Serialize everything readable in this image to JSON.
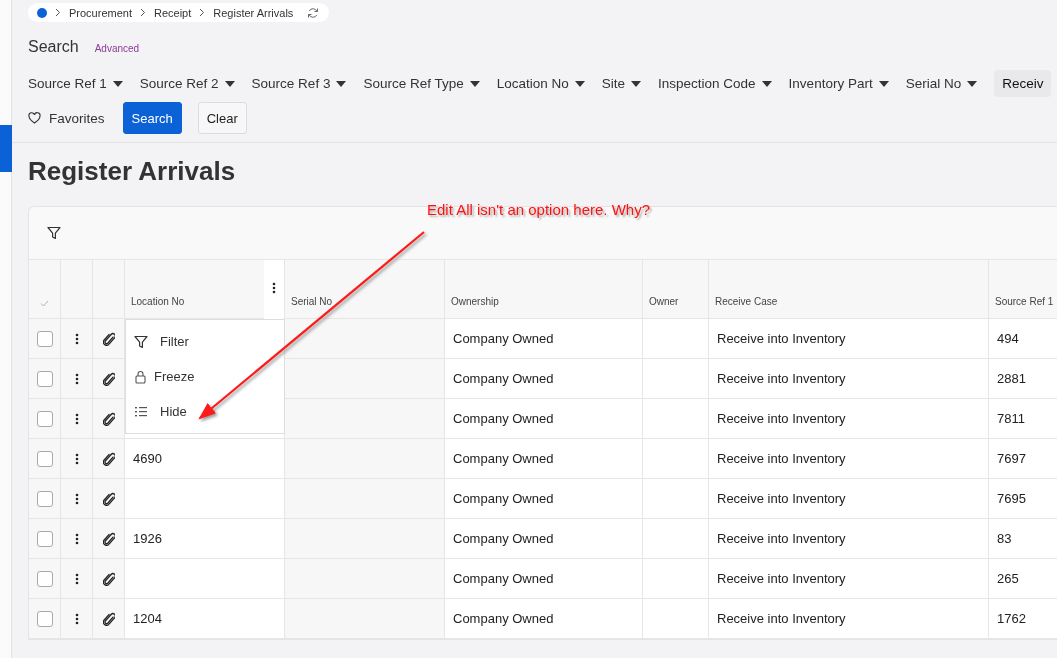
{
  "breadcrumb": [
    "Procurement",
    "Receipt",
    "Register Arrivals"
  ],
  "search": {
    "title": "Search",
    "advanced_link": "Advanced"
  },
  "filters": [
    {
      "label": "Source Ref 1",
      "active": false
    },
    {
      "label": "Source Ref 2",
      "active": false
    },
    {
      "label": "Source Ref 3",
      "active": false
    },
    {
      "label": "Source Ref Type",
      "active": false
    },
    {
      "label": "Location No",
      "active": false
    },
    {
      "label": "Site",
      "active": false
    },
    {
      "label": "Inspection Code",
      "active": false
    },
    {
      "label": "Inventory Part",
      "active": false
    },
    {
      "label": "Serial No",
      "active": false
    },
    {
      "label": "Receiv",
      "active": true
    }
  ],
  "favorites": "Favorites",
  "buttons": [
    {
      "label": "Search",
      "kind": "primary"
    },
    {
      "label": "Clear",
      "kind": "secondary"
    }
  ],
  "page_title": "Register Arrivals",
  "table": {
    "columns": [
      "Location No",
      "Serial No",
      "Ownership",
      "Owner",
      "Receive Case",
      "Source Ref 1"
    ],
    "rows": [
      {
        "checked": false,
        "location_no": null,
        "ownership": "Company Owned",
        "receive_case": "Receive into Inventory",
        "source_ref_1": "494"
      },
      {
        "checked": false,
        "location_no": null,
        "ownership": "Company Owned",
        "receive_case": "Receive into Inventory",
        "source_ref_1": "2881"
      },
      {
        "checked": false,
        "location_no": null,
        "ownership": "Company Owned",
        "receive_case": "Receive into Inventory",
        "source_ref_1": "7811"
      },
      {
        "checked": false,
        "location_no": "4690",
        "ownership": "Company Owned",
        "receive_case": "Receive into Inventory",
        "source_ref_1": "7697"
      },
      {
        "checked": false,
        "location_no": null,
        "ownership": "Company Owned",
        "receive_case": "Receive into Inventory",
        "source_ref_1": "7695"
      },
      {
        "checked": false,
        "location_no": "1926",
        "ownership": "Company Owned",
        "receive_case": "Receive into Inventory",
        "source_ref_1": "83"
      },
      {
        "checked": false,
        "location_no": null,
        "ownership": "Company Owned",
        "receive_case": "Receive into Inventory",
        "source_ref_1": "265"
      },
      {
        "checked": false,
        "location_no": "1204",
        "ownership": "Company Owned",
        "receive_case": "Receive into Inventory",
        "source_ref_1": "1762"
      }
    ]
  },
  "column_menu": [
    "Filter",
    "Freeze",
    "Hide"
  ],
  "annotation": "Edit All isn't an option here. Why?"
}
